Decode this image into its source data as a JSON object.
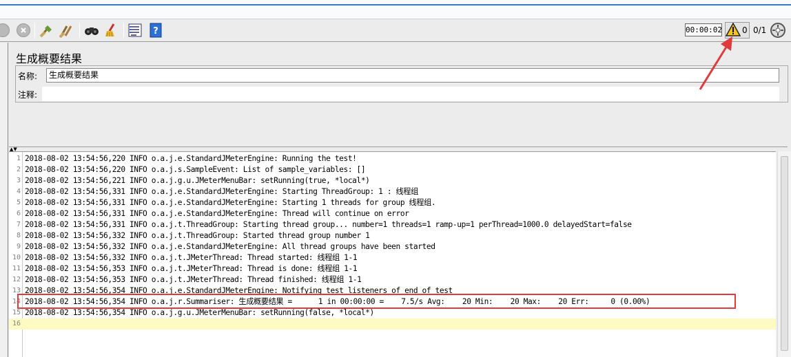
{
  "toolbar": {
    "timer": "00:00:02",
    "warning_count": "0",
    "thread_ratio": "0/1",
    "icons": [
      "stop-icon",
      "shutdown-icon",
      "clear-icon",
      "clear-all-icon",
      "search-icon",
      "reset-search-icon",
      "function-helper-icon",
      "help-icon",
      "warning-icon",
      "remote-icon"
    ]
  },
  "panel": {
    "title": "生成概要结果",
    "name_label": "名称:",
    "name_value": "生成概要结果",
    "comment_label": "注释:",
    "comment_value": ""
  },
  "log": {
    "lines": [
      {
        "n": "1",
        "text": "2018-08-02 13:54:56,220 INFO o.a.j.e.StandardJMeterEngine: Running the test!"
      },
      {
        "n": "2",
        "text": "2018-08-02 13:54:56,220 INFO o.a.j.s.SampleEvent: List of sample_variables: []"
      },
      {
        "n": "3",
        "text": "2018-08-02 13:54:56,221 INFO o.a.j.g.u.JMeterMenuBar: setRunning(true, *local*)"
      },
      {
        "n": "4",
        "text": "2018-08-02 13:54:56,331 INFO o.a.j.e.StandardJMeterEngine: Starting ThreadGroup: 1 : 线程组"
      },
      {
        "n": "5",
        "text": "2018-08-02 13:54:56,331 INFO o.a.j.e.StandardJMeterEngine: Starting 1 threads for group 线程组."
      },
      {
        "n": "6",
        "text": "2018-08-02 13:54:56,331 INFO o.a.j.e.StandardJMeterEngine: Thread will continue on error"
      },
      {
        "n": "7",
        "text": "2018-08-02 13:54:56,331 INFO o.a.j.t.ThreadGroup: Starting thread group... number=1 threads=1 ramp-up=1 perThread=1000.0 delayedStart=false"
      },
      {
        "n": "8",
        "text": "2018-08-02 13:54:56,332 INFO o.a.j.t.ThreadGroup: Started thread group number 1"
      },
      {
        "n": "9",
        "text": "2018-08-02 13:54:56,332 INFO o.a.j.e.StandardJMeterEngine: All thread groups have been started"
      },
      {
        "n": "10",
        "text": "2018-08-02 13:54:56,332 INFO o.a.j.t.JMeterThread: Thread started: 线程组 1-1"
      },
      {
        "n": "11",
        "text": "2018-08-02 13:54:56,353 INFO o.a.j.t.JMeterThread: Thread is done: 线程组 1-1"
      },
      {
        "n": "12",
        "text": "2018-08-02 13:54:56,353 INFO o.a.j.t.JMeterThread: Thread finished: 线程组 1-1"
      },
      {
        "n": "13",
        "text": "2018-08-02 13:54:56,354 INFO o.a.j.e.StandardJMeterEngine: Notifying test listeners of end of test"
      },
      {
        "n": "14",
        "text": "2018-08-02 13:54:56,354 INFO o.a.j.r.Summariser: 生成概要结果 =      1 in 00:00:00 =    7.5/s Avg:    20 Min:    20 Max:    20 Err:     0 (0.00%)"
      },
      {
        "n": "15",
        "text": "2018-08-02 13:54:56,354 INFO o.a.j.g.u.JMeterMenuBar: setRunning(false, *local*)"
      },
      {
        "n": "16",
        "text": ""
      }
    ]
  },
  "colors": {
    "annotation": "#e03a3a",
    "current_line": "#fdfbc2",
    "title_line": "#3a77c9"
  }
}
